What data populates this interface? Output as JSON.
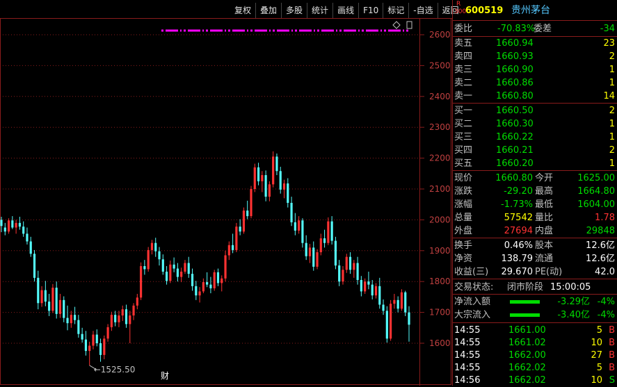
{
  "toolbar": [
    "复权",
    "叠加",
    "多股",
    "统计",
    "画线",
    "F10",
    "标记",
    "-自选",
    "返回"
  ],
  "header": {
    "badge_top": "R",
    "badge_bottom": "300",
    "code": "600519",
    "name": "贵州茅台"
  },
  "committee": {
    "ratio_label": "委比",
    "ratio": "-70.83%",
    "diff_label": "委差",
    "diff": "-34"
  },
  "asks": [
    {
      "label": "卖五",
      "price": "1660.94",
      "vol": "23"
    },
    {
      "label": "卖四",
      "price": "1660.93",
      "vol": "2"
    },
    {
      "label": "卖三",
      "price": "1660.90",
      "vol": "1"
    },
    {
      "label": "卖二",
      "price": "1660.86",
      "vol": "1"
    },
    {
      "label": "卖一",
      "price": "1660.80",
      "vol": "14"
    }
  ],
  "bids": [
    {
      "label": "买一",
      "price": "1660.50",
      "vol": "2"
    },
    {
      "label": "买二",
      "price": "1660.30",
      "vol": "1"
    },
    {
      "label": "买三",
      "price": "1660.22",
      "vol": "1"
    },
    {
      "label": "买四",
      "price": "1660.21",
      "vol": "2"
    },
    {
      "label": "买五",
      "price": "1660.20",
      "vol": "1"
    }
  ],
  "quote": [
    {
      "l1": "现价",
      "v1": "1660.80",
      "c1": "green",
      "l2": "今开",
      "v2": "1625.00",
      "c2": "green"
    },
    {
      "l1": "涨跌",
      "v1": "-29.20",
      "c1": "green",
      "l2": "最高",
      "v2": "1664.80",
      "c2": "green"
    },
    {
      "l1": "涨幅",
      "v1": "-1.73%",
      "c1": "green",
      "l2": "最低",
      "v2": "1604.00",
      "c2": "green"
    },
    {
      "l1": "总量",
      "v1": "57542",
      "c1": "yellow",
      "l2": "量比",
      "v2": "1.78",
      "c2": "red"
    },
    {
      "l1": "外盘",
      "v1": "27694",
      "c1": "red",
      "l2": "内盘",
      "v2": "29848",
      "c2": "green"
    }
  ],
  "stats": [
    {
      "l1": "换手",
      "v1": "0.46%",
      "l2": "股本",
      "v2": "12.6亿"
    },
    {
      "l1": "净资",
      "v1": "138.79",
      "l2": "流通",
      "v2": "12.6亿"
    },
    {
      "l1": "收益(三)",
      "v1": "29.670",
      "l2": "PE(动)",
      "v2": "42.0"
    }
  ],
  "trade_status": {
    "label": "交易状态:",
    "value": "闭市阶段",
    "time": "15:00:05"
  },
  "flows": [
    {
      "label": "净流入额",
      "value": "-3.29亿",
      "pct": "-4%",
      "bar": 0.55
    },
    {
      "label": "大宗流入",
      "value": "-3.40亿",
      "pct": "-4%",
      "bar": 0.55
    }
  ],
  "ticks": [
    {
      "time": "14:55",
      "price": "1661.00",
      "vol": "5",
      "side": "B"
    },
    {
      "time": "14:55",
      "price": "1661.02",
      "vol": "10",
      "side": "B"
    },
    {
      "time": "14:55",
      "price": "1662.00",
      "vol": "27",
      "side": "B"
    },
    {
      "time": "14:55",
      "price": "1662.02",
      "vol": "5",
      "side": "B"
    },
    {
      "time": "14:56",
      "price": "1662.02",
      "vol": "10",
      "side": "S"
    }
  ],
  "chart_marker": "财",
  "chart_data": {
    "type": "candlestick",
    "ylim": [
      1525,
      2660
    ],
    "y_ticks": [
      1600,
      1700,
      1800,
      1900,
      2000,
      2100,
      2200,
      2300,
      2400,
      2500,
      2600
    ],
    "low_annotation": "1525.50",
    "colors": {
      "up": "#ff3232",
      "down": "#54fcfc",
      "axis": "#8a1c1c",
      "marker": "#ff00ff"
    },
    "candles": [
      [
        2000,
        2010,
        1960,
        1980
      ],
      [
        1975,
        1990,
        1950,
        1962
      ],
      [
        1962,
        2005,
        1955,
        1998
      ],
      [
        1998,
        2012,
        1970,
        1975
      ],
      [
        1975,
        2000,
        1955,
        1990
      ],
      [
        1990,
        2010,
        1968,
        1978
      ],
      [
        1978,
        1995,
        1945,
        1955
      ],
      [
        1955,
        1975,
        1920,
        1930
      ],
      [
        1930,
        1945,
        1880,
        1890
      ],
      [
        1890,
        1902,
        1800,
        1812
      ],
      [
        1812,
        1835,
        1710,
        1730
      ],
      [
        1730,
        1785,
        1718,
        1772
      ],
      [
        1772,
        1802,
        1720,
        1735
      ],
      [
        1735,
        1760,
        1688,
        1705
      ],
      [
        1705,
        1792,
        1698,
        1780
      ],
      [
        1780,
        1800,
        1680,
        1695
      ],
      [
        1695,
        1760,
        1682,
        1740
      ],
      [
        1740,
        1752,
        1668,
        1682
      ],
      [
        1682,
        1722,
        1642,
        1665
      ],
      [
        1665,
        1705,
        1650,
        1692
      ],
      [
        1692,
        1718,
        1662,
        1675
      ],
      [
        1675,
        1692,
        1618,
        1630
      ],
      [
        1630,
        1650,
        1602,
        1612
      ],
      [
        1612,
        1640,
        1560,
        1575
      ],
      [
        1575,
        1605,
        1528,
        1592
      ],
      [
        1592,
        1640,
        1580,
        1628
      ],
      [
        1628,
        1645,
        1590,
        1600
      ],
      [
        1600,
        1615,
        1540,
        1562
      ],
      [
        1562,
        1625,
        1548,
        1615
      ],
      [
        1615,
        1662,
        1605,
        1652
      ],
      [
        1652,
        1702,
        1640,
        1692
      ],
      [
        1692,
        1705,
        1655,
        1668
      ],
      [
        1668,
        1705,
        1652,
        1690
      ],
      [
        1690,
        1722,
        1672,
        1710
      ],
      [
        1710,
        1725,
        1650,
        1662
      ],
      [
        1662,
        1705,
        1600,
        1690
      ],
      [
        1690,
        1730,
        1675,
        1722
      ],
      [
        1722,
        1760,
        1710,
        1748
      ],
      [
        1748,
        1862,
        1740,
        1850
      ],
      [
        1850,
        1870,
        1822,
        1840
      ],
      [
        1840,
        1912,
        1832,
        1902
      ],
      [
        1902,
        1935,
        1888,
        1925
      ],
      [
        1925,
        1942,
        1880,
        1898
      ],
      [
        1898,
        1912,
        1852,
        1872
      ],
      [
        1872,
        1888,
        1822,
        1832
      ],
      [
        1832,
        1850,
        1790,
        1802
      ],
      [
        1802,
        1868,
        1795,
        1855
      ],
      [
        1855,
        1878,
        1830,
        1842
      ],
      [
        1842,
        1860,
        1800,
        1815
      ],
      [
        1815,
        1845,
        1798,
        1832
      ],
      [
        1832,
        1870,
        1825,
        1860
      ],
      [
        1860,
        1880,
        1812,
        1825
      ],
      [
        1825,
        1842,
        1770,
        1785
      ],
      [
        1785,
        1802,
        1740,
        1755
      ],
      [
        1755,
        1782,
        1732,
        1768
      ],
      [
        1768,
        1810,
        1762,
        1798
      ],
      [
        1798,
        1830,
        1782,
        1790
      ],
      [
        1790,
        1815,
        1762,
        1778
      ],
      [
        1778,
        1838,
        1770,
        1830
      ],
      [
        1830,
        1842,
        1785,
        1795
      ],
      [
        1795,
        1820,
        1768,
        1810
      ],
      [
        1810,
        1900,
        1800,
        1885
      ],
      [
        1885,
        1930,
        1870,
        1918
      ],
      [
        1918,
        1955,
        1892,
        1902
      ],
      [
        1902,
        1990,
        1895,
        1978
      ],
      [
        1978,
        2002,
        1950,
        1962
      ],
      [
        1962,
        2040,
        1955,
        2030
      ],
      [
        2030,
        2062,
        2002,
        2012
      ],
      [
        2012,
        2110,
        2005,
        2100
      ],
      [
        2100,
        2182,
        2090,
        2170
      ],
      [
        2170,
        2185,
        2112,
        2125
      ],
      [
        2125,
        2158,
        2090,
        2145
      ],
      [
        2145,
        2160,
        2060,
        2075
      ],
      [
        2075,
        2125,
        2060,
        2115
      ],
      [
        2115,
        2222,
        2105,
        2205
      ],
      [
        2205,
        2215,
        2145,
        2158
      ],
      [
        2158,
        2172,
        2085,
        2098
      ],
      [
        2098,
        2130,
        2070,
        2118
      ],
      [
        2118,
        2135,
        2040,
        2055
      ],
      [
        2055,
        2075,
        1980,
        1992
      ],
      [
        1992,
        2022,
        1950,
        1965
      ],
      [
        1965,
        2012,
        1955,
        1998
      ],
      [
        1998,
        2005,
        1910,
        1925
      ],
      [
        1925,
        1950,
        1870,
        1882
      ],
      [
        1882,
        1922,
        1860,
        1910
      ],
      [
        1910,
        1930,
        1835,
        1848
      ],
      [
        1848,
        1905,
        1840,
        1895
      ],
      [
        1895,
        1955,
        1885,
        1940
      ],
      [
        1940,
        1968,
        1910,
        1925
      ],
      [
        1925,
        2008,
        1918,
        1995
      ],
      [
        1995,
        2012,
        1920,
        1932
      ],
      [
        1932,
        1945,
        1840,
        1852
      ],
      [
        1852,
        1870,
        1785,
        1800
      ],
      [
        1800,
        1850,
        1790,
        1838
      ],
      [
        1838,
        1890,
        1828,
        1880
      ],
      [
        1880,
        1895,
        1825,
        1838
      ],
      [
        1838,
        1870,
        1812,
        1860
      ],
      [
        1860,
        1880,
        1790,
        1805
      ],
      [
        1805,
        1818,
        1752,
        1768
      ],
      [
        1768,
        1810,
        1760,
        1800
      ],
      [
        1800,
        1832,
        1775,
        1790
      ],
      [
        1790,
        1805,
        1742,
        1755
      ],
      [
        1755,
        1795,
        1745,
        1785
      ],
      [
        1785,
        1812,
        1712,
        1725
      ],
      [
        1725,
        1742,
        1692,
        1705
      ],
      [
        1705,
        1720,
        1602,
        1615
      ],
      [
        1615,
        1740,
        1608,
        1728
      ],
      [
        1728,
        1760,
        1712,
        1740
      ],
      [
        1740,
        1752,
        1700,
        1712
      ],
      [
        1712,
        1775,
        1705,
        1765
      ],
      [
        1765,
        1770,
        1688,
        1700
      ],
      [
        1700,
        1720,
        1605,
        1660
      ]
    ]
  }
}
